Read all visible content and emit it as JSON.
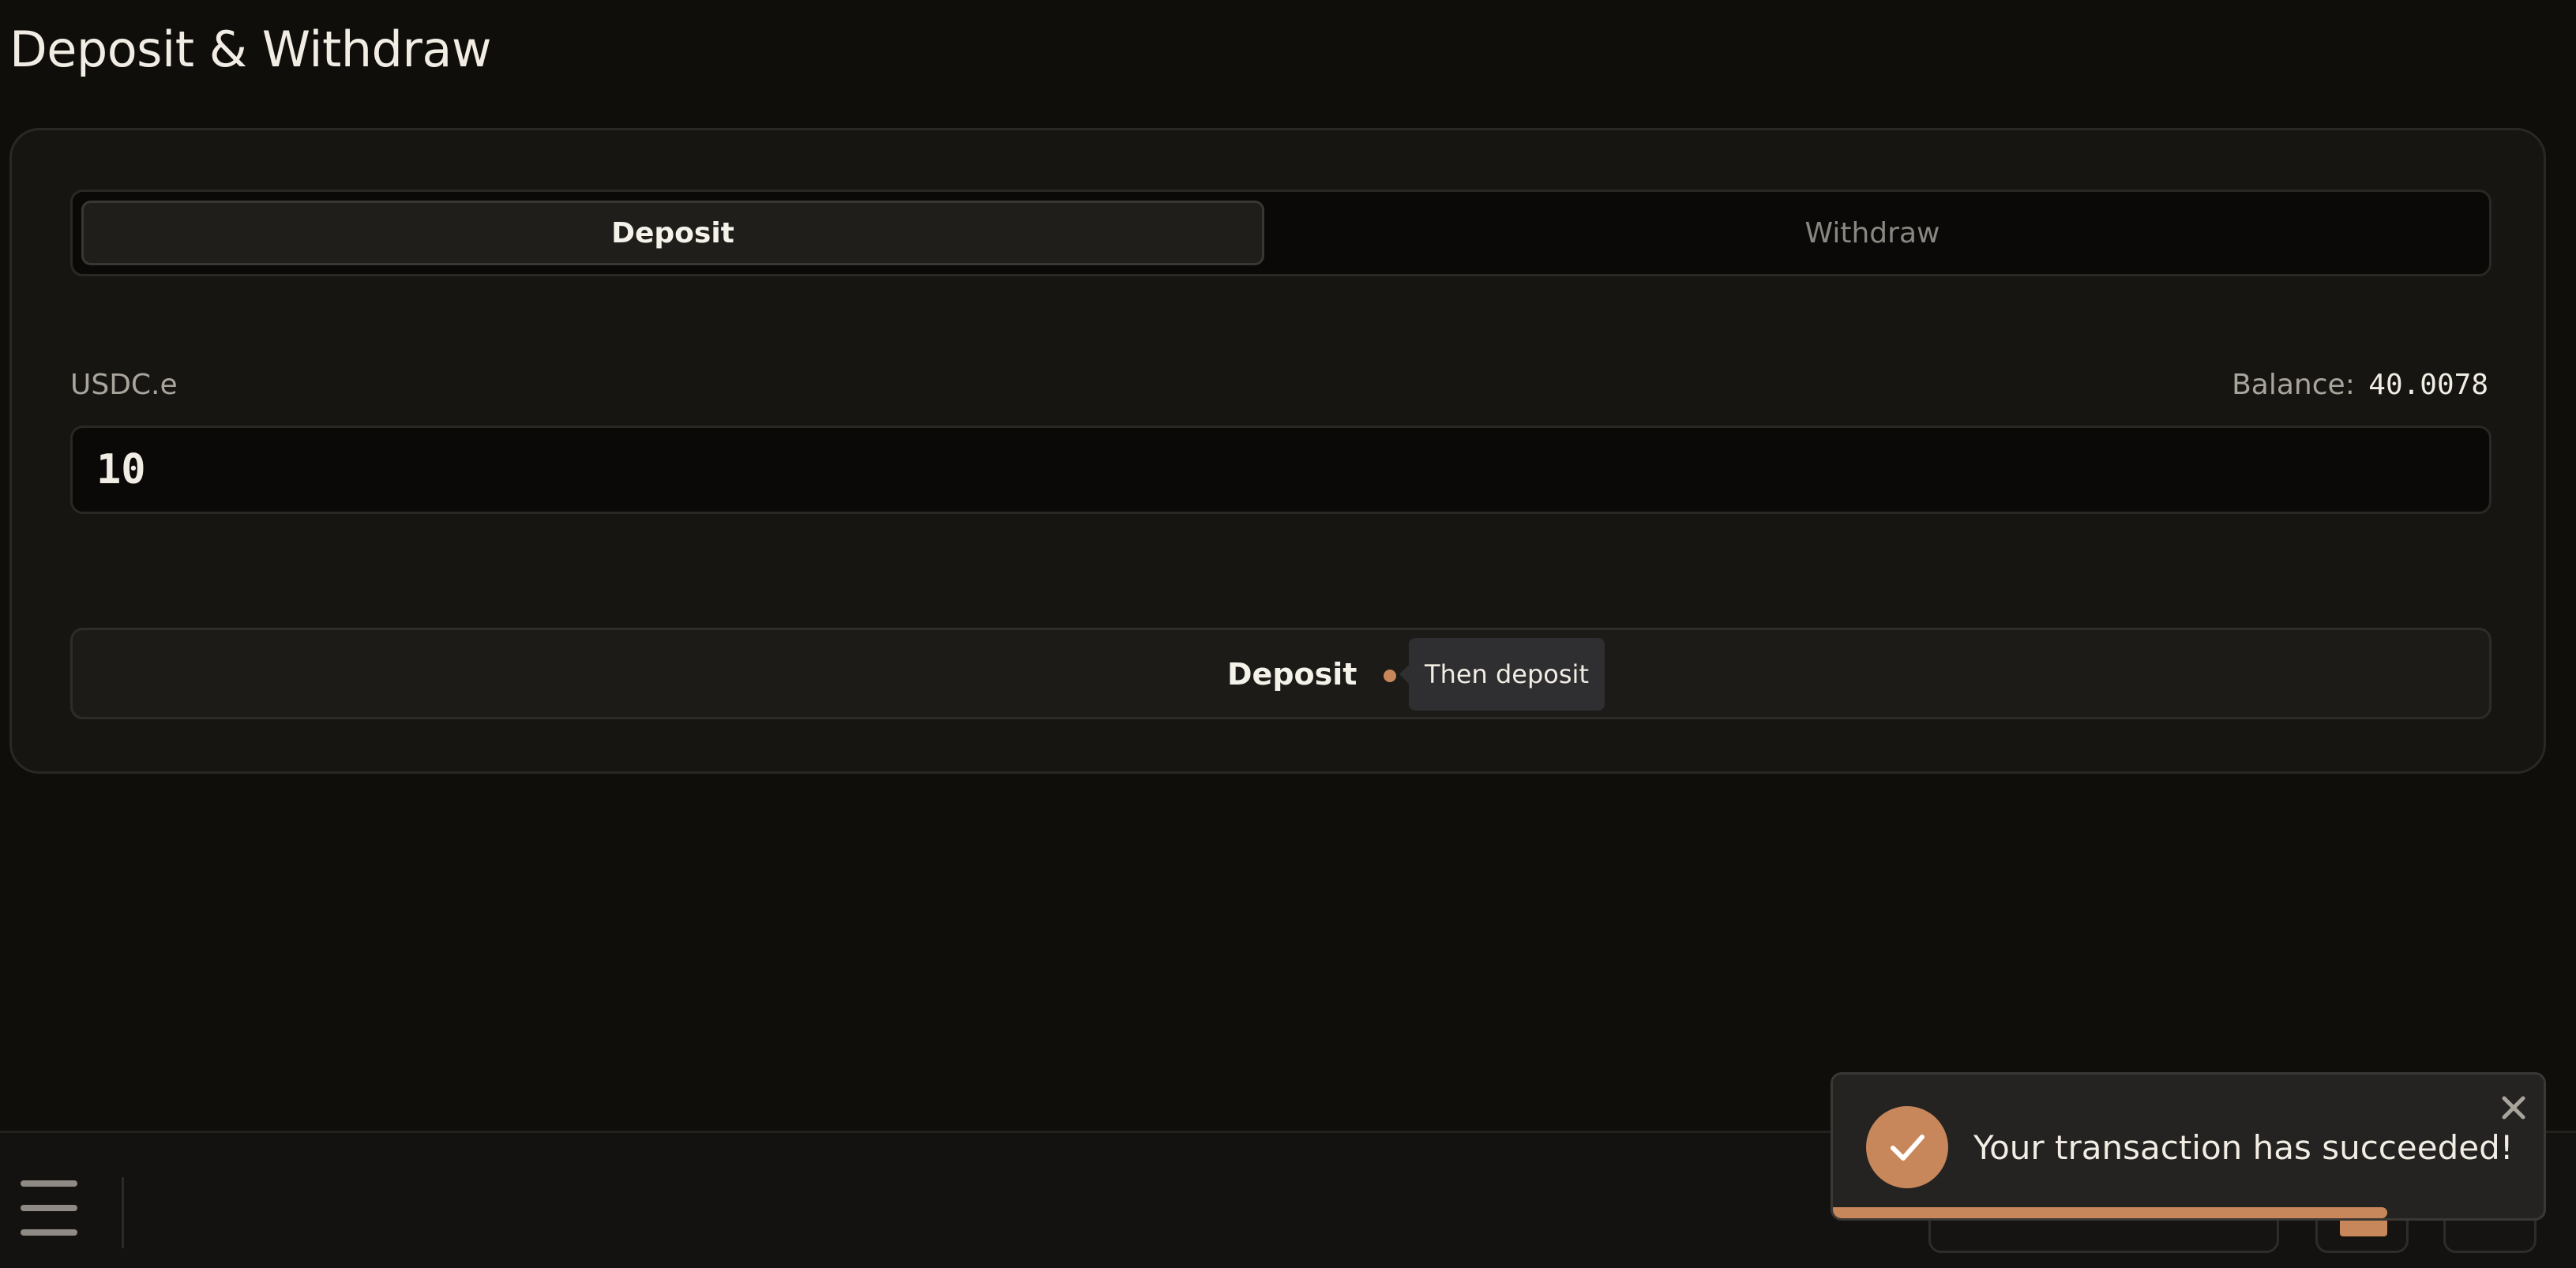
{
  "page": {
    "title": "Deposit & Withdraw"
  },
  "tabs": [
    {
      "label": "Deposit",
      "active": true
    },
    {
      "label": "Withdraw",
      "active": false
    }
  ],
  "form": {
    "asset": "USDC.e",
    "balance_label": "Balance:",
    "balance_value": "40.0078",
    "amount_value": "10",
    "submit_label": "Deposit",
    "tooltip": "Then deposit"
  },
  "toast": {
    "message": "Your transaction has succeeded!",
    "icon": "check-icon",
    "progress_fraction": 0.78
  },
  "colors": {
    "accent": "#c8875a",
    "background": "#100e0a",
    "card": "#171512"
  }
}
